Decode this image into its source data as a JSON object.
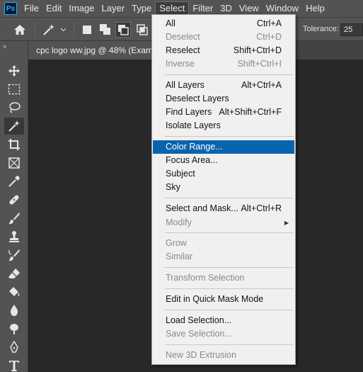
{
  "menubar": {
    "logo": "Ps",
    "items": [
      "File",
      "Edit",
      "Image",
      "Layer",
      "Type",
      "Select",
      "Filter",
      "3D",
      "View",
      "Window",
      "Help"
    ],
    "active_index": 5
  },
  "options": {
    "tolerance_label": "Tolerance:",
    "tolerance_value": "25"
  },
  "toolbar": {
    "collapse": "»",
    "tools": [
      "move-tool",
      "marquee-tool",
      "lasso-tool",
      "magic-wand-tool",
      "crop-tool",
      "frame-tool",
      "eyedropper-tool",
      "healing-brush-tool",
      "brush-tool",
      "clone-stamp-tool",
      "history-brush-tool",
      "eraser-tool",
      "paint-bucket-tool",
      "blur-tool",
      "dodge-tool",
      "pen-tool",
      "type-tool"
    ],
    "selected": "magic-wand-tool"
  },
  "document": {
    "tab_title": "cpc logo ww.jpg @ 48% (Examc"
  },
  "select_menu": {
    "items": [
      {
        "label": "All",
        "shortcut": "Ctrl+A",
        "enabled": true
      },
      {
        "label": "Deselect",
        "shortcut": "Ctrl+D",
        "enabled": false
      },
      {
        "label": "Reselect",
        "shortcut": "Shift+Ctrl+D",
        "enabled": true
      },
      {
        "label": "Inverse",
        "shortcut": "Shift+Ctrl+I",
        "enabled": false
      },
      {
        "label": "All Layers",
        "shortcut": "Alt+Ctrl+A",
        "enabled": true
      },
      {
        "label": "Deselect Layers",
        "shortcut": "",
        "enabled": true
      },
      {
        "label": "Find Layers",
        "shortcut": "Alt+Shift+Ctrl+F",
        "enabled": true
      },
      {
        "label": "Isolate Layers",
        "shortcut": "",
        "enabled": true
      },
      {
        "label": "Color Range...",
        "shortcut": "",
        "enabled": true,
        "highlighted": true
      },
      {
        "label": "Focus Area...",
        "shortcut": "",
        "enabled": true
      },
      {
        "label": "Subject",
        "shortcut": "",
        "enabled": true
      },
      {
        "label": "Sky",
        "shortcut": "",
        "enabled": true
      },
      {
        "label": "Select and Mask...",
        "shortcut": "Alt+Ctrl+R",
        "enabled": true
      },
      {
        "label": "Modify",
        "shortcut": "",
        "enabled": false,
        "submenu": true
      },
      {
        "label": "Grow",
        "shortcut": "",
        "enabled": false
      },
      {
        "label": "Similar",
        "shortcut": "",
        "enabled": false
      },
      {
        "label": "Transform Selection",
        "shortcut": "",
        "enabled": false
      },
      {
        "label": "Edit in Quick Mask Mode",
        "shortcut": "",
        "enabled": true
      },
      {
        "label": "Load Selection...",
        "shortcut": "",
        "enabled": true
      },
      {
        "label": "Save Selection...",
        "shortcut": "",
        "enabled": false
      },
      {
        "label": "New 3D Extrusion",
        "shortcut": "",
        "enabled": false
      }
    ]
  },
  "colors": {
    "highlight": "#0a64ad",
    "panel": "#535353",
    "canvas": "#282828",
    "menu_bg": "#f0f0f0"
  }
}
